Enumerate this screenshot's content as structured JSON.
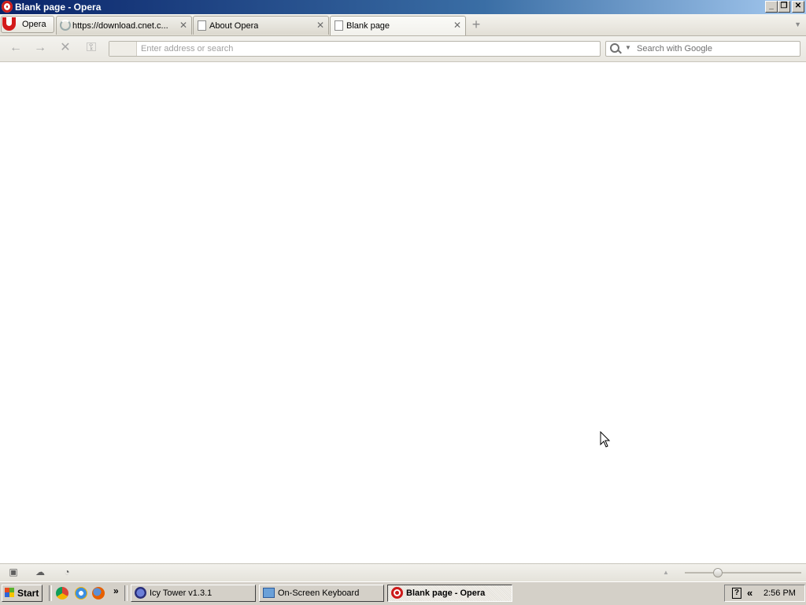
{
  "window": {
    "title": "Blank page - Opera",
    "minimize_glyph": "_",
    "restore_glyph": "❐",
    "close_glyph": "✕"
  },
  "tabbar": {
    "menu_label": "Opera",
    "tabs": [
      {
        "label": "https://download.cnet.c...",
        "icon": "loading-spinner-icon",
        "active": false
      },
      {
        "label": "About Opera",
        "icon": "page-icon",
        "active": false
      },
      {
        "label": "Blank page",
        "icon": "page-icon",
        "active": true
      }
    ],
    "new_tab_glyph": "+",
    "close_glyph": "✕",
    "tab_menu_glyph": "▼"
  },
  "navbar": {
    "back_glyph": "←",
    "forward_glyph": "→",
    "stop_glyph": "✕",
    "key_glyph": "⚿",
    "address_value": "",
    "address_placeholder": "Enter address or search",
    "search_placeholder": "Search with Google",
    "search_dropdown_glyph": "▼"
  },
  "statusbar": {
    "panel_glyph": "▣",
    "cloud_glyph": "☁",
    "speed_glyph": "◔",
    "zoom_up_glyph": "▲"
  },
  "taskbar": {
    "start_label": "Start",
    "quicklaunch_more": "»",
    "items": [
      {
        "label": "Icy Tower v1.3.1",
        "active": false
      },
      {
        "label": "On-Screen Keyboard",
        "active": false
      },
      {
        "label": "Blank page - Opera",
        "active": true
      }
    ],
    "tray_help": "?",
    "tray_chevron": "«",
    "clock": "2:56 PM"
  },
  "colors": {
    "title_bar": "#0a246a",
    "opera_red": "#cc1a1a",
    "taskbar": "#d4d0c8"
  }
}
